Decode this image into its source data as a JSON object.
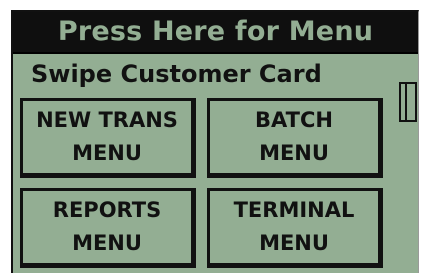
{
  "header": {
    "title": "Press Here for Menu"
  },
  "prompt": {
    "text": "Swipe Customer Card"
  },
  "buttons": [
    {
      "line1": "NEW TRANS",
      "line2": "MENU"
    },
    {
      "line1": "BATCH",
      "line2": "MENU"
    },
    {
      "line1": "REPORTS",
      "line2": "MENU"
    },
    {
      "line1": "TERMINAL",
      "line2": "MENU"
    }
  ],
  "colors": {
    "lcd_background": "#93ae93",
    "header_bar": "#0f0f0f",
    "ink": "#111111"
  },
  "icons": {
    "card_slot": "card-slot-icon"
  }
}
